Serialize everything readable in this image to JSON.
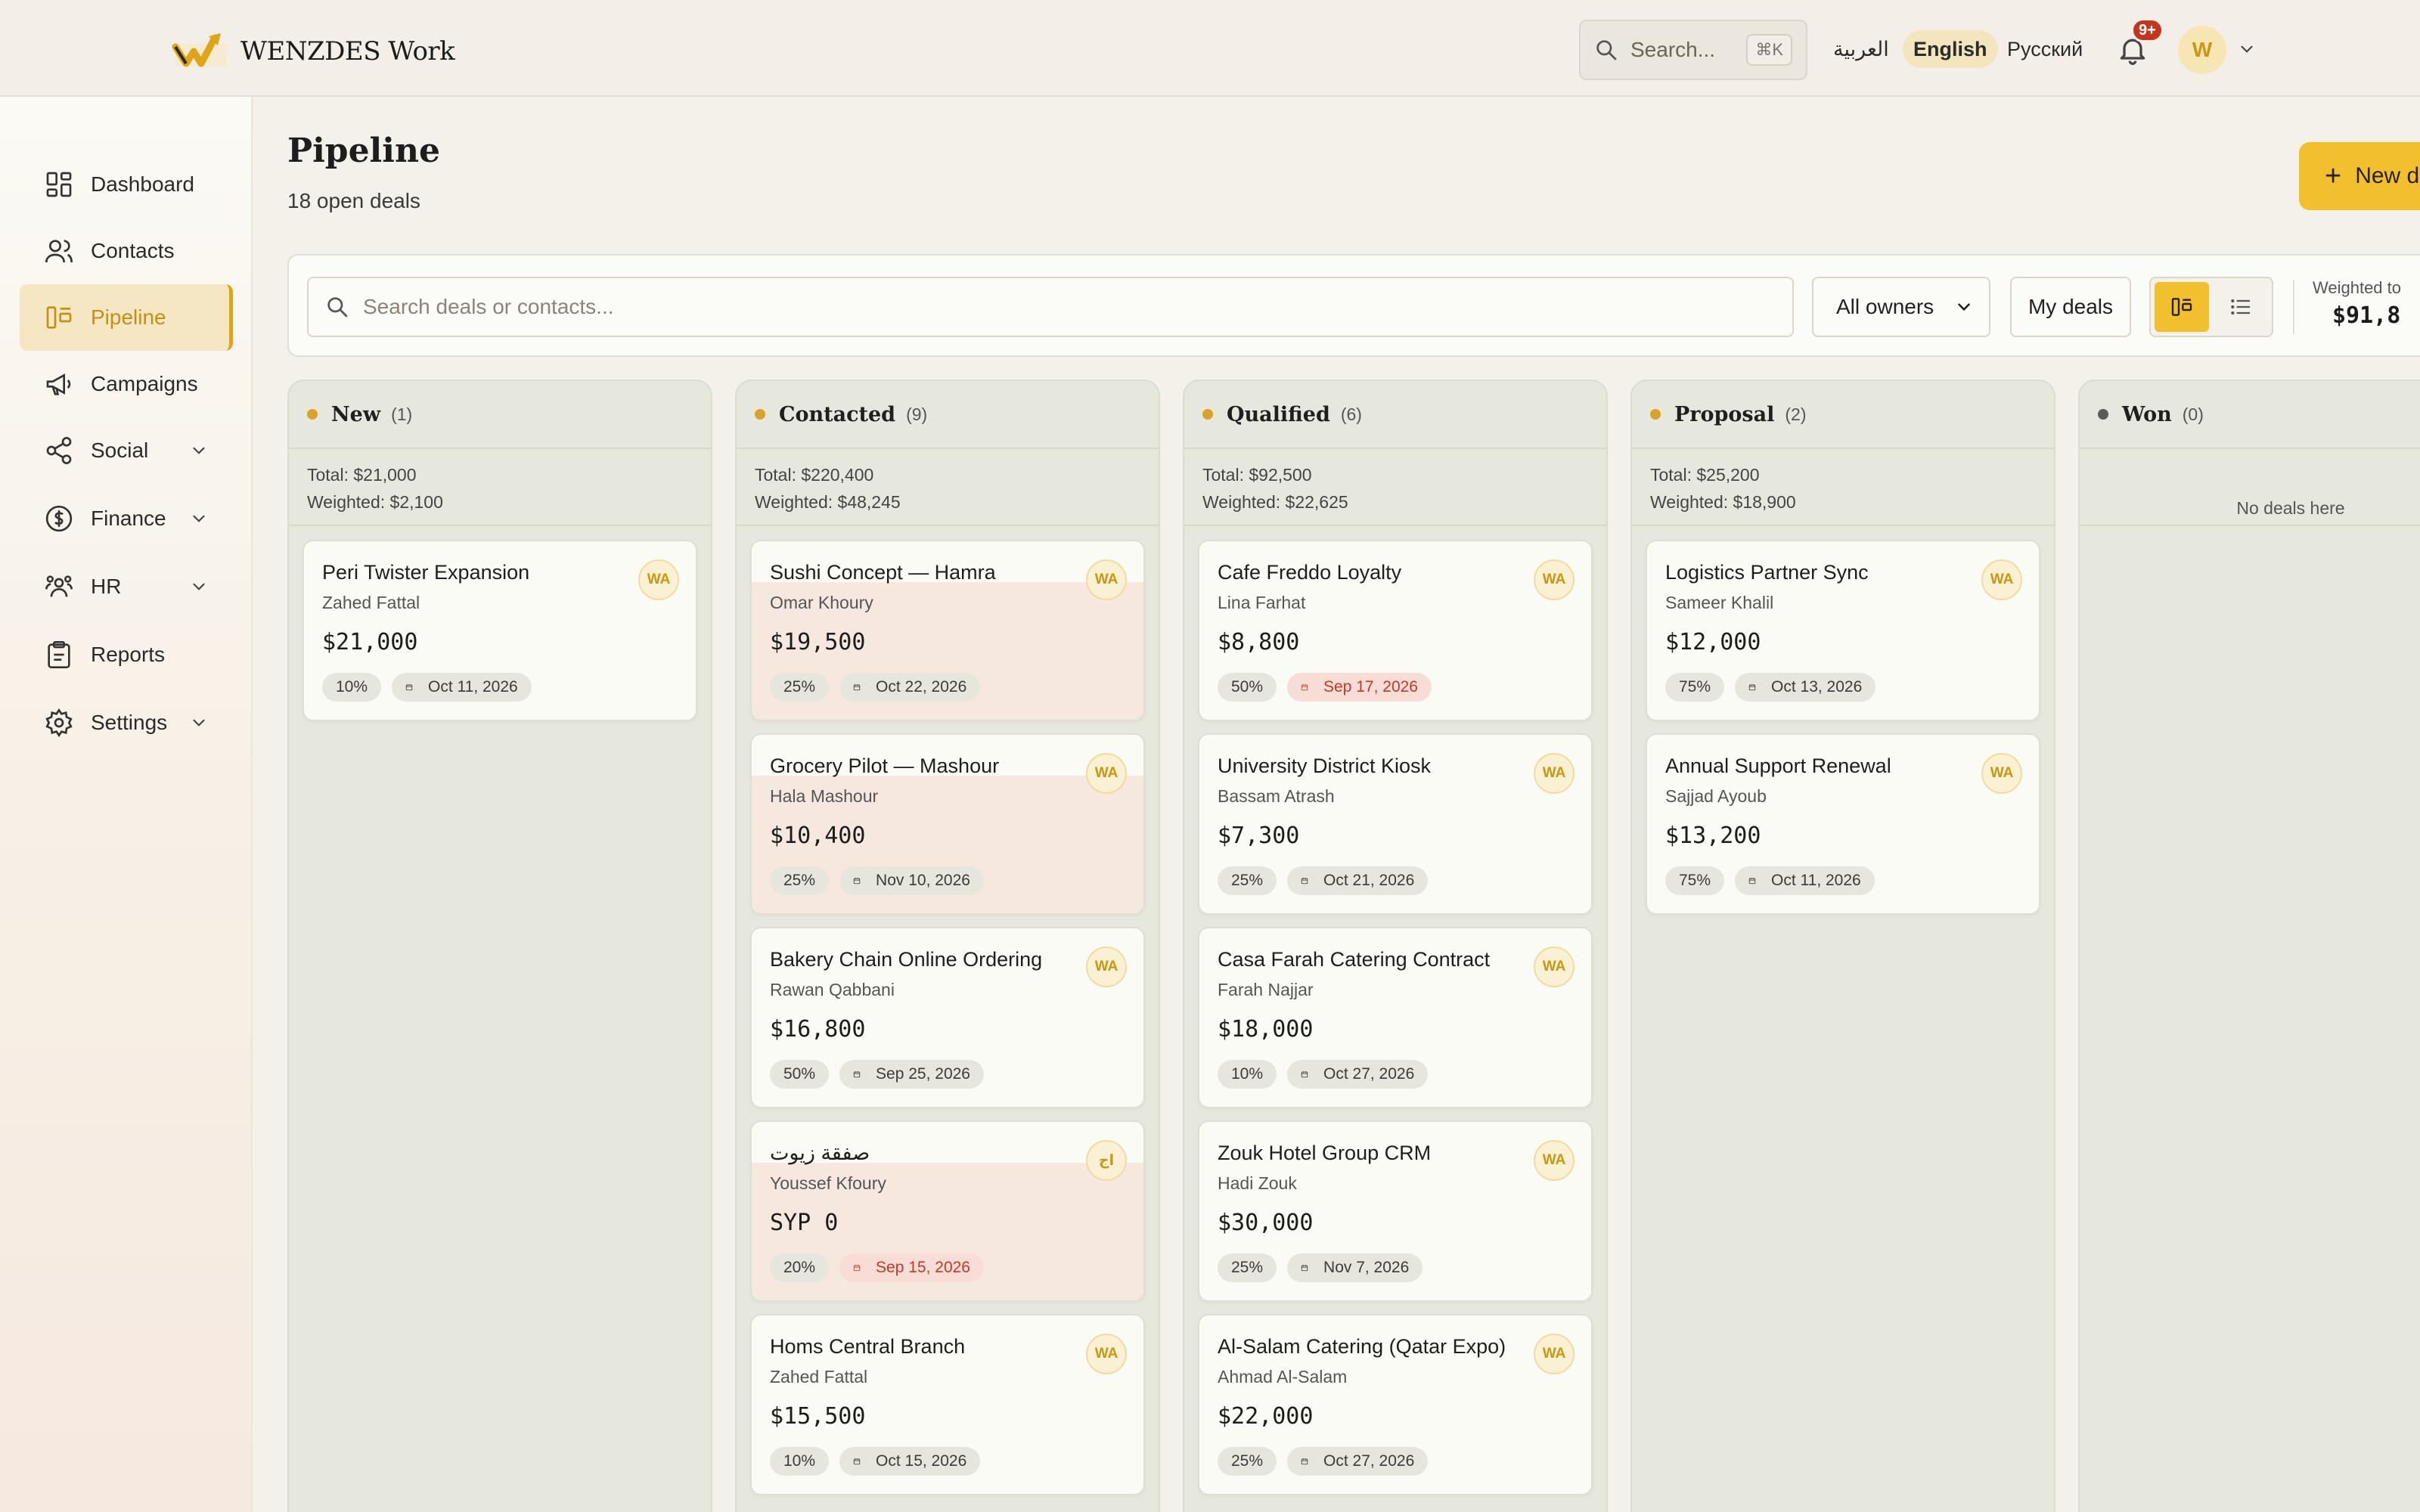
{
  "brand": {
    "name": "WENZDES Work",
    "accent": "#f2c02f",
    "logo_icon": "wenzdes-logo"
  },
  "topbar": {
    "search_placeholder": "Search...",
    "search_shortcut": "⌘K",
    "languages": [
      "العربية",
      "English",
      "Русский"
    ],
    "active_language": "English",
    "notifications_badge": "9+",
    "avatar_initial": "W"
  },
  "sidebar": {
    "items": [
      {
        "label": "Dashboard",
        "icon": "dashboard-icon"
      },
      {
        "label": "Contacts",
        "icon": "users-icon"
      },
      {
        "label": "Pipeline",
        "icon": "kanban-icon",
        "active": true
      },
      {
        "label": "Campaigns",
        "icon": "megaphone-icon"
      },
      {
        "label": "Social",
        "icon": "share-icon",
        "expandable": true
      },
      {
        "label": "Finance",
        "icon": "dollar-icon",
        "expandable": true
      },
      {
        "label": "HR",
        "icon": "team-icon",
        "expandable": true
      },
      {
        "label": "Reports",
        "icon": "clipboard-icon"
      },
      {
        "label": "Settings",
        "icon": "gear-icon",
        "expandable": true
      }
    ]
  },
  "page": {
    "title": "Pipeline",
    "subtitle": "18 open deals",
    "new_deal_label": "New de"
  },
  "toolbar": {
    "search_placeholder": "Search deals or contacts...",
    "owner_filter": "All owners",
    "my_deals": "My deals",
    "weighted_label": "Weighted to",
    "weighted_value": "$91,8"
  },
  "columns": [
    {
      "name": "New",
      "count": "(1)",
      "total": "Total: $21,000",
      "weighted": "Weighted: $2,100",
      "cards": [
        {
          "title": "Peri Twister Expansion",
          "contact": "Zahed Fattal",
          "amount": "$21,000",
          "prob": "10%",
          "date": "Oct 11, 2026",
          "owner": "WA",
          "overdue": false,
          "tint": false
        }
      ]
    },
    {
      "name": "Contacted",
      "count": "(9)",
      "total": "Total: $220,400",
      "weighted": "Weighted: $48,245",
      "cards": [
        {
          "title": "Sushi Concept — Hamra",
          "contact": "Omar Khoury",
          "amount": "$19,500",
          "prob": "25%",
          "date": "Oct 22, 2026",
          "owner": "WA",
          "overdue": false,
          "tint": true
        },
        {
          "title": "Grocery Pilot — Mashour",
          "contact": "Hala Mashour",
          "amount": "$10,400",
          "prob": "25%",
          "date": "Nov 10, 2026",
          "owner": "WA",
          "overdue": false,
          "tint": true
        },
        {
          "title": "Bakery Chain Online Ordering",
          "contact": "Rawan Qabbani",
          "amount": "$16,800",
          "prob": "50%",
          "date": "Sep 25, 2026",
          "owner": "WA",
          "overdue": false,
          "tint": false
        },
        {
          "title": "صفقة زيوت",
          "contact": "Youssef Kfoury",
          "amount": "SYP 0",
          "prob": "20%",
          "date": "Sep 15, 2026",
          "owner": "اج",
          "overdue": true,
          "tint": true
        },
        {
          "title": "Homs Central Branch",
          "contact": "Zahed Fattal",
          "amount": "$15,500",
          "prob": "10%",
          "date": "Oct 15, 2026",
          "owner": "WA",
          "overdue": false,
          "tint": false
        }
      ]
    },
    {
      "name": "Qualified",
      "count": "(6)",
      "total": "Total: $92,500",
      "weighted": "Weighted: $22,625",
      "cards": [
        {
          "title": "Cafe Freddo Loyalty",
          "contact": "Lina Farhat",
          "amount": "$8,800",
          "prob": "50%",
          "date": "Sep 17, 2026",
          "owner": "WA",
          "overdue": true,
          "tint": false
        },
        {
          "title": "University District Kiosk",
          "contact": "Bassam Atrash",
          "amount": "$7,300",
          "prob": "25%",
          "date": "Oct 21, 2026",
          "owner": "WA",
          "overdue": false,
          "tint": false
        },
        {
          "title": "Casa Farah Catering Contract",
          "contact": "Farah Najjar",
          "amount": "$18,000",
          "prob": "10%",
          "date": "Oct 27, 2026",
          "owner": "WA",
          "overdue": false,
          "tint": false
        },
        {
          "title": "Zouk Hotel Group CRM",
          "contact": "Hadi Zouk",
          "amount": "$30,000",
          "prob": "25%",
          "date": "Nov 7, 2026",
          "owner": "WA",
          "overdue": false,
          "tint": false
        },
        {
          "title": "Al-Salam Catering (Qatar Expo)",
          "contact": "Ahmad Al-Salam",
          "amount": "$22,000",
          "prob": "25%",
          "date": "Oct 27, 2026",
          "owner": "WA",
          "overdue": false,
          "tint": false
        }
      ]
    },
    {
      "name": "Proposal",
      "count": "(2)",
      "total": "Total: $25,200",
      "weighted": "Weighted: $18,900",
      "cards": [
        {
          "title": "Logistics Partner Sync",
          "contact": "Sameer Khalil",
          "amount": "$12,000",
          "prob": "75%",
          "date": "Oct 13, 2026",
          "owner": "WA",
          "overdue": false,
          "tint": false
        },
        {
          "title": "Annual Support Renewal",
          "contact": "Sajjad Ayoub",
          "amount": "$13,200",
          "prob": "75%",
          "date": "Oct 11, 2026",
          "owner": "WA",
          "overdue": false,
          "tint": false
        }
      ]
    },
    {
      "name": "Won",
      "count": "(0)",
      "empty_text": "No deals here",
      "cards": []
    }
  ]
}
